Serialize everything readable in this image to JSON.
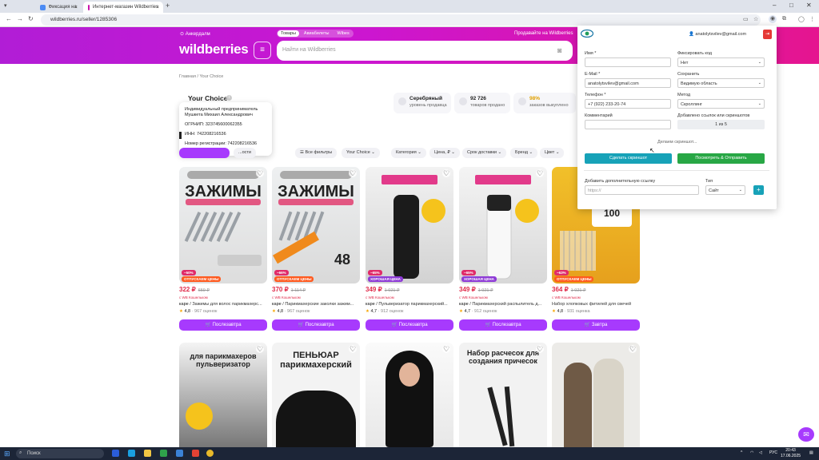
{
  "browser": {
    "tabs": [
      {
        "title": "Фиксация нарушений в интернете",
        "favicon_color": "#4b8bf4"
      },
      {
        "title": "Интернет-магазин Wildberries",
        "favicon_color": "#cb11ab"
      }
    ],
    "url": "wildberries.ru/seller/1285306"
  },
  "wb": {
    "location": "Анкердалм",
    "top_tabs": [
      "Товары",
      "Авиабилеты",
      "Wibes"
    ],
    "seller_link": "Продавайте на Wildberries",
    "logo": "wildberries",
    "search_placeholder": "Найти на Wildberries",
    "breadcrumbs": "Главная  /  Your Choice",
    "seller_name": "Your Choice",
    "stats": [
      {
        "value": "Серебряный",
        "label": "уровень продавца"
      },
      {
        "value": "92 726",
        "label": "товаров продано"
      },
      {
        "value": "98%",
        "label": "заказов выкуплено"
      }
    ],
    "tooltip": {
      "ip": "Индивидуальный предприниматель Мушкета Михаил Александрович",
      "ogrnip": "ОГРНИП: 323745600062355",
      "inn": "ИНН: 742208216536",
      "reg": "Номер регистрации: 742208216536"
    },
    "filters": [
      "...ости",
      "Все фильтры",
      "Your Choice",
      "Категория",
      "Цена, ₽",
      "Срок доставки",
      "Бренд",
      "Цвет"
    ]
  },
  "products": [
    {
      "price": "322 ₽",
      "old": "659 ₽",
      "discount": "−50%",
      "promo": "ОТПУСКАЕМ ЦЕНЫ",
      "wallet": "с WB Кошельком",
      "brand": "карe",
      "title": "Зажимы для волос парикмахерс...",
      "rating": "4,8",
      "reviews": "967 оценок",
      "button": "Послезавтра"
    },
    {
      "price": "370 ₽",
      "old": "1 114 ₽",
      "discount": "−66%",
      "promo": "ОТПУСКАЕМ ЦЕНЫ",
      "wallet": "с WB Кошельком",
      "brand": "карe",
      "title": "Парикмахерские заколки зажим...",
      "rating": "4,8",
      "reviews": "967 оценок",
      "button": "Послезавтра"
    },
    {
      "price": "349 ₽",
      "old": "1 021 ₽",
      "discount": "−65%",
      "promo": "ХОРОШАЯ ЦЕНА",
      "wallet": "с WB Кошельком",
      "brand": "карe",
      "title": "Пульверизатор парикмахерский...",
      "rating": "4,7",
      "reviews": "912 оценок",
      "button": "Послезавтра"
    },
    {
      "price": "349 ₽",
      "old": "1 021 ₽",
      "discount": "−65%",
      "promo": "ХОРОШАЯ ЦЕНА",
      "wallet": "с WB Кошельком",
      "brand": "карe",
      "title": "Парикмахерский распылитель д...",
      "rating": "4,7",
      "reviews": "912 оценок",
      "button": "Послезавтра"
    },
    {
      "price": "364 ₽",
      "old": "1 021 ₽",
      "discount": "−63%",
      "promo": "ОТПУСКАЕМ ЦЕНЫ",
      "wallet": "с WB Кошельком",
      "brand": "",
      "title": "Набор хлопковых фитилей для свечей",
      "rating": "4,8",
      "reviews": "931 оценка",
      "button": "Завтра"
    }
  ],
  "product_row2_labels": [
    "для парикмахеров пульверизатор",
    "ПЕНЬЮАР парикмахерский",
    "",
    "Набор расчесок для создания причесок",
    ""
  ],
  "ext": {
    "user": "anatolytsvilev@gmail.com",
    "fields": {
      "name_label": "Имя *",
      "name_value": "",
      "fix_label": "Фиксировать код",
      "fix_value": "Нет",
      "email_label": "E-Mail *",
      "email_value": "anatolytsvilev@gmail.com",
      "save_label": "Сохранить",
      "save_value": "Видимую область",
      "phone_label": "Телефон *",
      "phone_value": "+7 (922) 233-20-74",
      "method_label": "Метод",
      "method_value": "Скроллинг",
      "comment_label": "Комментарий",
      "comment_value": "",
      "links_label": "Добавлено ссылок или скриншотов",
      "links_value": "1 из 5"
    },
    "screens_text": "Делаем скриншот...",
    "btn_screenshot": "Сделать скриншот",
    "btn_send": "Посмотреть & Отправить",
    "add_link_label": "Добавить дополнительную ссылку",
    "add_link_placeholder": "https://",
    "type_label": "Тип",
    "type_value": "Сайт",
    "add_btn": "+"
  },
  "taskbar": {
    "search": "Поиск",
    "lang": "РУС",
    "time": "20:43",
    "date": "17.06.2025"
  }
}
